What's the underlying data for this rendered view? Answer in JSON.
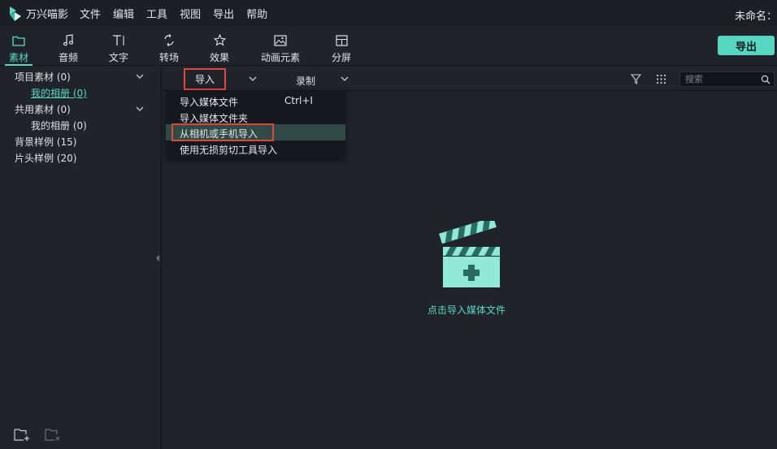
{
  "app": {
    "name": "万兴喵影",
    "document_title": "未命名："
  },
  "menu": [
    "文件",
    "编辑",
    "工具",
    "视图",
    "导出",
    "帮助"
  ],
  "toolbar": {
    "tabs": [
      {
        "label": "素材",
        "icon": "folder-icon",
        "active": true
      },
      {
        "label": "音频",
        "icon": "music-note-icon",
        "active": false
      },
      {
        "label": "文字",
        "icon": "text-icon",
        "active": false
      },
      {
        "label": "转场",
        "icon": "transition-icon",
        "active": false
      },
      {
        "label": "效果",
        "icon": "effects-star-icon",
        "active": false
      },
      {
        "label": "动画元素",
        "icon": "image-icon",
        "active": false
      },
      {
        "label": "分屏",
        "icon": "split-screen-icon",
        "active": false
      }
    ],
    "export_label": "导出"
  },
  "sidebar": {
    "items": [
      {
        "label": "项目素材 (0)",
        "level": 0,
        "expandable": true
      },
      {
        "label": "我的相册 (0)",
        "level": 1,
        "selected": true
      },
      {
        "label": "共用素材 (0)",
        "level": 0,
        "expandable": true
      },
      {
        "label": "我的相册 (0)",
        "level": 1
      },
      {
        "label": "背景样例 (15)",
        "level": 0
      },
      {
        "label": "片头样例 (20)",
        "level": 0
      }
    ],
    "footer_icons": [
      "add-folder-icon",
      "delete-folder-icon"
    ]
  },
  "content_toolbar": {
    "import_label": "导入",
    "record_label": "录制",
    "search_placeholder": "搜索"
  },
  "import_menu": {
    "items": [
      {
        "label": "导入媒体文件",
        "shortcut": "Ctrl+I"
      },
      {
        "label": "导入媒体文件夹",
        "shortcut": ""
      },
      {
        "label": "从相机或手机导入",
        "shortcut": "",
        "hovered": true,
        "highlighted": true
      },
      {
        "label": "使用无损剪切工具导入",
        "shortcut": ""
      }
    ]
  },
  "empty_state": {
    "label": "点击导入媒体文件",
    "icon": "clapperboard-add-icon"
  },
  "colors": {
    "accent": "#5fd8c3",
    "highlight_outline": "#e0463a",
    "background": "#1e232c"
  }
}
